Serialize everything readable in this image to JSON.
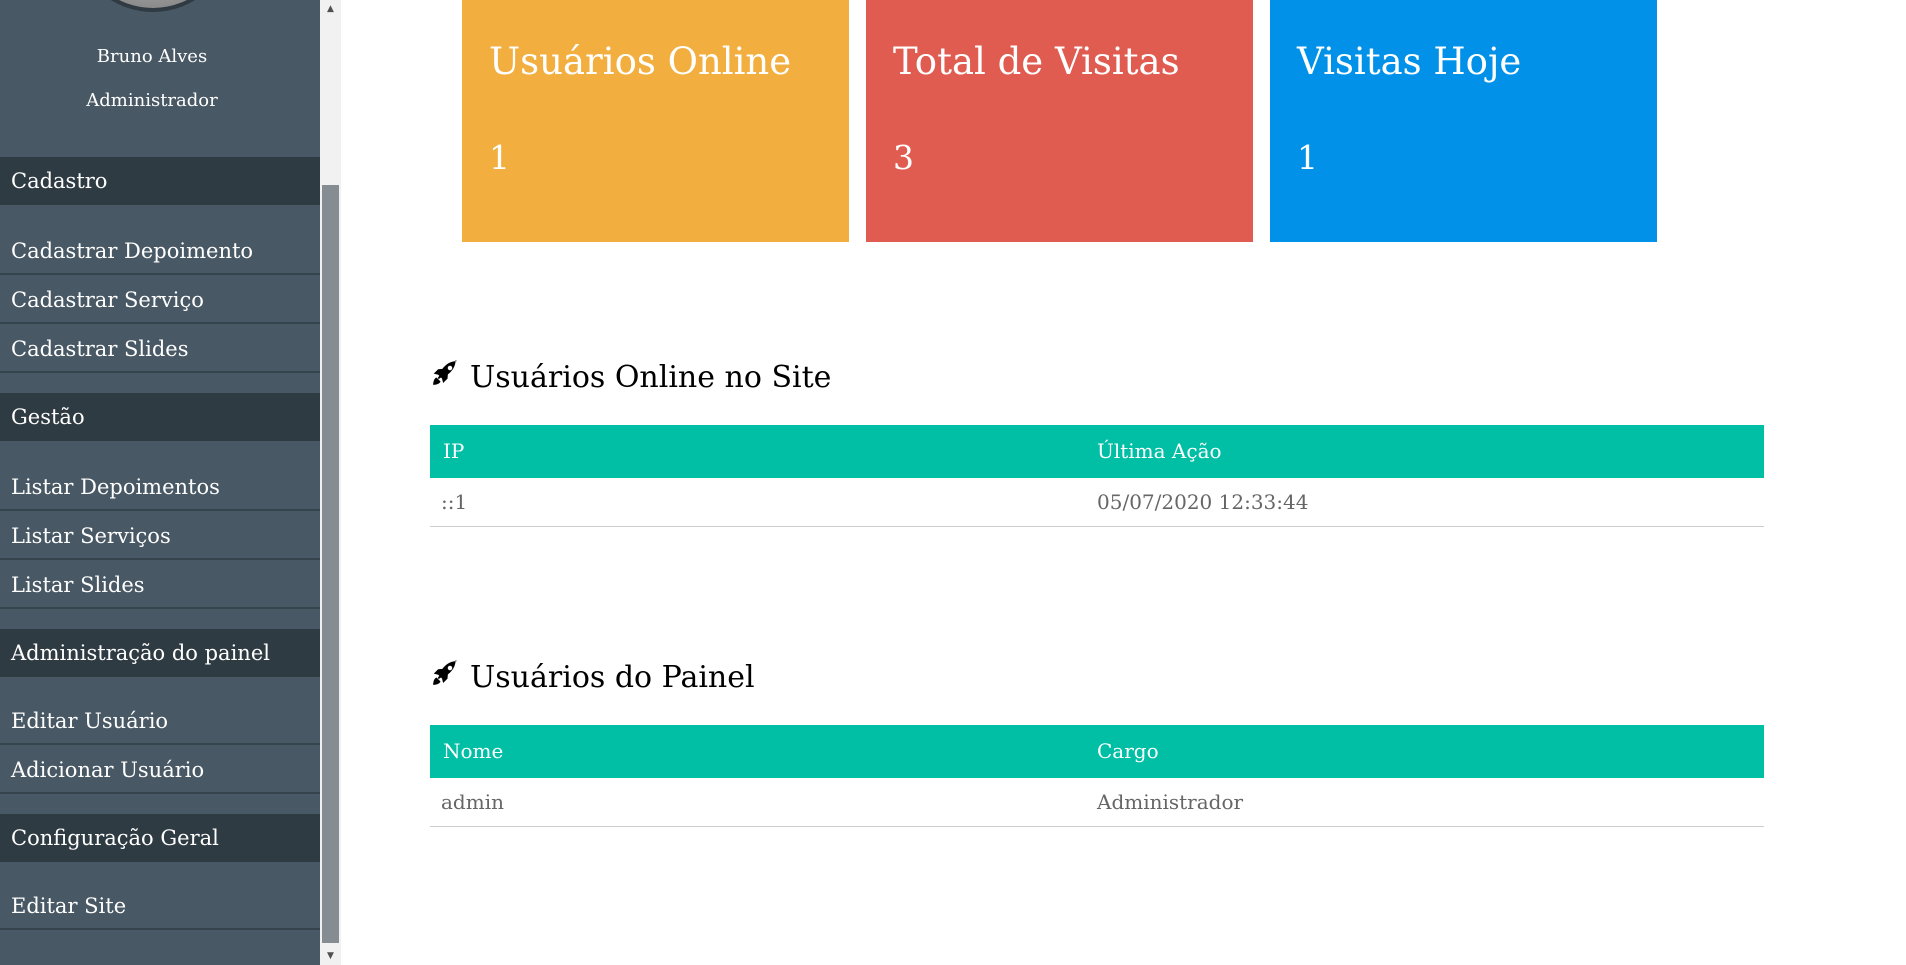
{
  "user": {
    "name": "Bruno Alves",
    "role": "Administrador"
  },
  "sidebar": {
    "sections": [
      {
        "header": "Cadastro",
        "items": [
          "Cadastrar Depoimento",
          "Cadastrar Serviço",
          "Cadastrar Slides"
        ]
      },
      {
        "header": "Gestão",
        "items": [
          "Listar Depoimentos",
          "Listar Serviços",
          "Listar Slides"
        ]
      },
      {
        "header": "Administração do painel",
        "items": [
          "Editar Usuário",
          "Adicionar Usuário"
        ]
      },
      {
        "header": "Configuração Geral",
        "items": [
          "Editar Site"
        ]
      }
    ]
  },
  "stats": [
    {
      "title": "Usuários Online",
      "value": "1",
      "color": "#f2ae3f"
    },
    {
      "title": "Total de Visitas",
      "value": "3",
      "color": "#e05c50"
    },
    {
      "title": "Visitas Hoje",
      "value": "1",
      "color": "#0191e9"
    }
  ],
  "online_users": {
    "title": "Usuários Online no Site",
    "icon": "rocket-icon",
    "columns": [
      "IP",
      "Última Ação"
    ],
    "rows": [
      [
        "::1",
        "05/07/2020 12:33:44"
      ]
    ]
  },
  "panel_users": {
    "title": "Usuários do Painel",
    "icon": "rocket-icon",
    "columns": [
      "Nome",
      "Cargo"
    ],
    "rows": [
      [
        "admin",
        "Administrador"
      ]
    ]
  },
  "colors": {
    "sidebar_bg": "#485864",
    "sidebar_header_bg": "#2f3b42",
    "table_header_bg": "#00bfa5"
  }
}
